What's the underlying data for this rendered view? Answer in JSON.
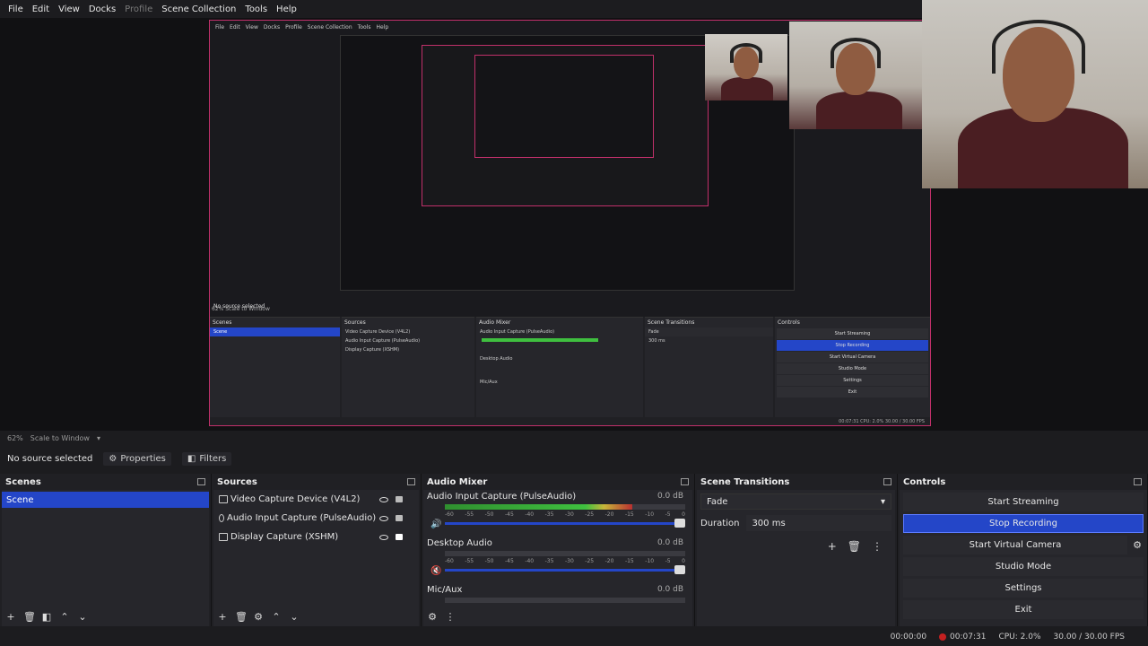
{
  "menu": [
    "File",
    "Edit",
    "View",
    "Docks",
    "Profile",
    "Scene Collection",
    "Tools",
    "Help"
  ],
  "scale": {
    "zoom": "62%",
    "mode": "Scale to Window"
  },
  "toolbar": {
    "selection": "No source selected",
    "properties": "Properties",
    "filters": "Filters"
  },
  "scenes": {
    "title": "Scenes",
    "items": [
      "Scene"
    ]
  },
  "sources": {
    "title": "Sources",
    "items": [
      {
        "label": "Video Capture Device (V4L2)",
        "icon": "camera-icon"
      },
      {
        "label": "Audio Input Capture (PulseAudio)",
        "icon": "microphone-icon"
      },
      {
        "label": "Display Capture (XSHM)",
        "icon": "monitor-icon"
      }
    ]
  },
  "mixer": {
    "title": "Audio Mixer",
    "channels": [
      {
        "name": "Audio Input Capture (PulseAudio)",
        "db": "0.0 dB",
        "level": 0.78
      },
      {
        "name": "Desktop Audio",
        "db": "0.0 dB",
        "level": 0.0
      },
      {
        "name": "Mic/Aux",
        "db": "0.0 dB",
        "level": 0.0
      }
    ],
    "ticks": [
      "-60",
      "-55",
      "-50",
      "-45",
      "-40",
      "-35",
      "-30",
      "-25",
      "-20",
      "-15",
      "-10",
      "-5",
      "0"
    ]
  },
  "transitions": {
    "title": "Scene Transitions",
    "selected": "Fade",
    "duration_label": "Duration",
    "duration": "300 ms"
  },
  "controls": {
    "title": "Controls",
    "buttons": [
      "Start Streaming",
      "Stop Recording",
      "Start Virtual Camera",
      "Studio Mode",
      "Settings",
      "Exit"
    ]
  },
  "status": {
    "stream_time": "00:00:00",
    "rec_time": "00:07:31",
    "cpu": "CPU: 2.0%",
    "fps": "30.00 / 30.00 FPS"
  },
  "nested": {
    "menu": [
      "File",
      "Edit",
      "View",
      "Docks",
      "Profile",
      "Scene Collection",
      "Tools",
      "Help"
    ],
    "selection": "No source selected",
    "scale": "62%   Scale to Window",
    "status": "00:07:31   CPU: 2.0%   30.00 / 30.00 FPS"
  }
}
